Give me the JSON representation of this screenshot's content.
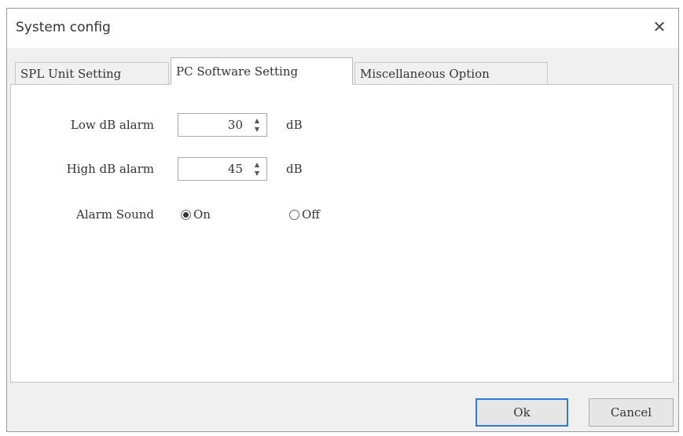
{
  "window": {
    "title": "System config",
    "close_label": "✕"
  },
  "tabs": [
    {
      "label": "SPL Unit Setting",
      "active": false
    },
    {
      "label": "PC Software Setting",
      "active": true
    },
    {
      "label": "Miscellaneous Option",
      "active": false
    }
  ],
  "settings": {
    "low_alarm": {
      "label": "Low dB alarm",
      "value": "30",
      "unit": "dB"
    },
    "high_alarm": {
      "label": "High dB alarm",
      "value": "45",
      "unit": "dB"
    },
    "alarm_sound": {
      "label": "Alarm Sound",
      "options": [
        "On",
        "Off"
      ],
      "selected": "On"
    }
  },
  "buttons": {
    "ok": "Ok",
    "cancel": "Cancel"
  },
  "icons": {
    "spin_up": "▲",
    "spin_down": "▼"
  }
}
